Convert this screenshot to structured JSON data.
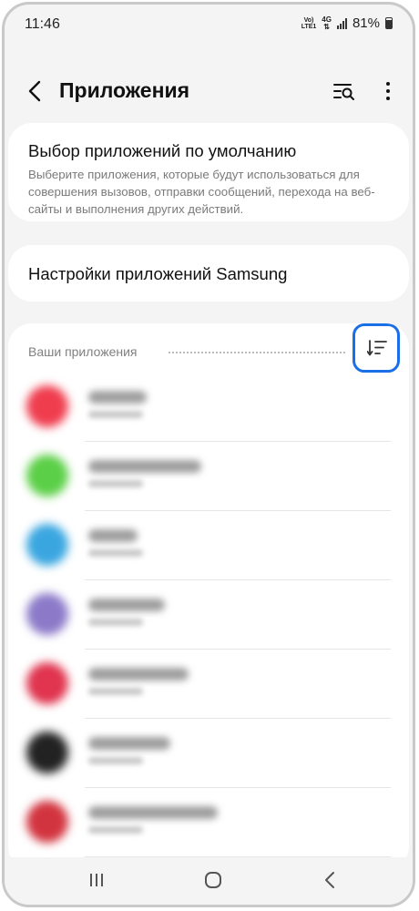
{
  "status_bar": {
    "time": "11:46",
    "network_top": "Vo)",
    "network_bottom": "LTE1",
    "network_type": "4G",
    "battery": "81%"
  },
  "header": {
    "title": "Приложения",
    "icons": [
      "back-icon",
      "search-list-icon",
      "more-icon"
    ]
  },
  "default_apps": {
    "title": "Выбор приложений по умолчанию",
    "description": "Выберите приложения, которые будут использоваться для совершения вызовов, отправки сообщений, перехода на веб-сайты и выполнения других действий."
  },
  "samsung_settings": {
    "title": "Настройки приложений Samsung"
  },
  "your_apps": {
    "section_title": "Ваши приложения",
    "sort_icon": "sort-icon",
    "apps": [
      {
        "color": "#ef3d4e"
      },
      {
        "color": "#5bcf47"
      },
      {
        "color": "#3aa6e0"
      },
      {
        "color": "#8c7ac9"
      },
      {
        "color": "#e0344f"
      },
      {
        "color": "#222222"
      },
      {
        "color": "#d2343f"
      }
    ]
  },
  "navbar": {
    "icons": [
      "recent-apps-icon",
      "home-icon",
      "nav-back-icon"
    ]
  },
  "accent_color": "#1a6ee6"
}
